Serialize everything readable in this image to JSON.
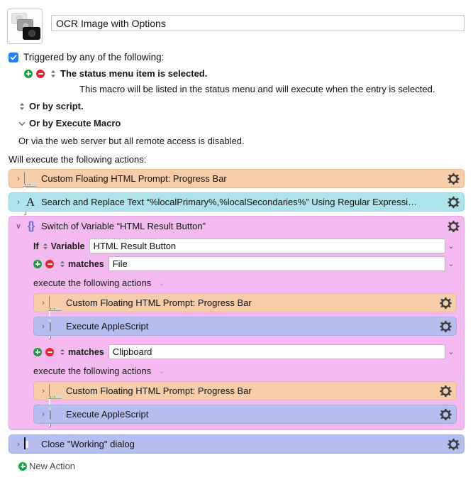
{
  "macro": {
    "icon_name": "stacked-screenshots-icon",
    "title": "OCR Image with Options"
  },
  "trigger": {
    "checkbox_checked": true,
    "header_label": "Triggered by any of the following:",
    "items": [
      {
        "title": "The status menu item is selected.",
        "description": "This macro will be listed in the status menu and will execute when the entry is selected."
      }
    ],
    "or_by_script": "Or by script.",
    "or_by_execute_macro": "Or by Execute Macro",
    "web_server_note": "Or via the web server but all remote access is disabled."
  },
  "actions_header": "Will execute the following actions:",
  "actions": [
    {
      "label": "Custom Floating HTML Prompt: Progress Bar",
      "color": "row-peach",
      "icon": "window-icon",
      "disclosure": "›"
    },
    {
      "label": "Search and Replace Text “%localPrimary%,%localSecondaries%” Using Regular Expressi…",
      "color": "row-cyan",
      "icon": "letter-a-icon",
      "disclosure": "›"
    }
  ],
  "switch": {
    "label": "Switch of Variable “HTML Result Button”",
    "color": "row-pink",
    "icon": "curly-braces-icon",
    "disclosure": "∨",
    "if_prefix": "If",
    "variable_label": "Variable",
    "variable_value": "HTML Result Button",
    "cases": [
      {
        "operator": "matches",
        "value": "File",
        "execute_label": "execute the following actions",
        "actions": [
          {
            "label": "Custom Floating HTML Prompt: Progress Bar",
            "color": "row-peach",
            "icon": "window-icon",
            "disclosure": "›"
          },
          {
            "label": "Execute AppleScript",
            "color": "row-blue",
            "icon": "document-icon",
            "disclosure": "›"
          }
        ]
      },
      {
        "operator": "matches",
        "value": "Clipboard",
        "execute_label": "execute the following actions",
        "actions": [
          {
            "label": "Custom Floating HTML Prompt: Progress Bar",
            "color": "row-peach",
            "icon": "window-icon",
            "disclosure": "›"
          },
          {
            "label": "Execute AppleScript",
            "color": "row-blue",
            "icon": "document-icon",
            "disclosure": "›"
          }
        ]
      }
    ]
  },
  "trailing_actions": [
    {
      "label": "Close \"Working\" dialog",
      "color": "row-blue",
      "icon": "dark-window-icon",
      "disclosure": "›"
    }
  ],
  "new_action_label": "New Action",
  "colors": {
    "peach": "#f7cda7",
    "cyan": "#ade4ec",
    "pink": "#f3b9f0",
    "blue": "#b6bdef",
    "checkbox_blue": "#1a83ff",
    "add_green": "#13a03c",
    "remove_red": "#e0262c",
    "braces_purple": "#6a6fd6"
  }
}
